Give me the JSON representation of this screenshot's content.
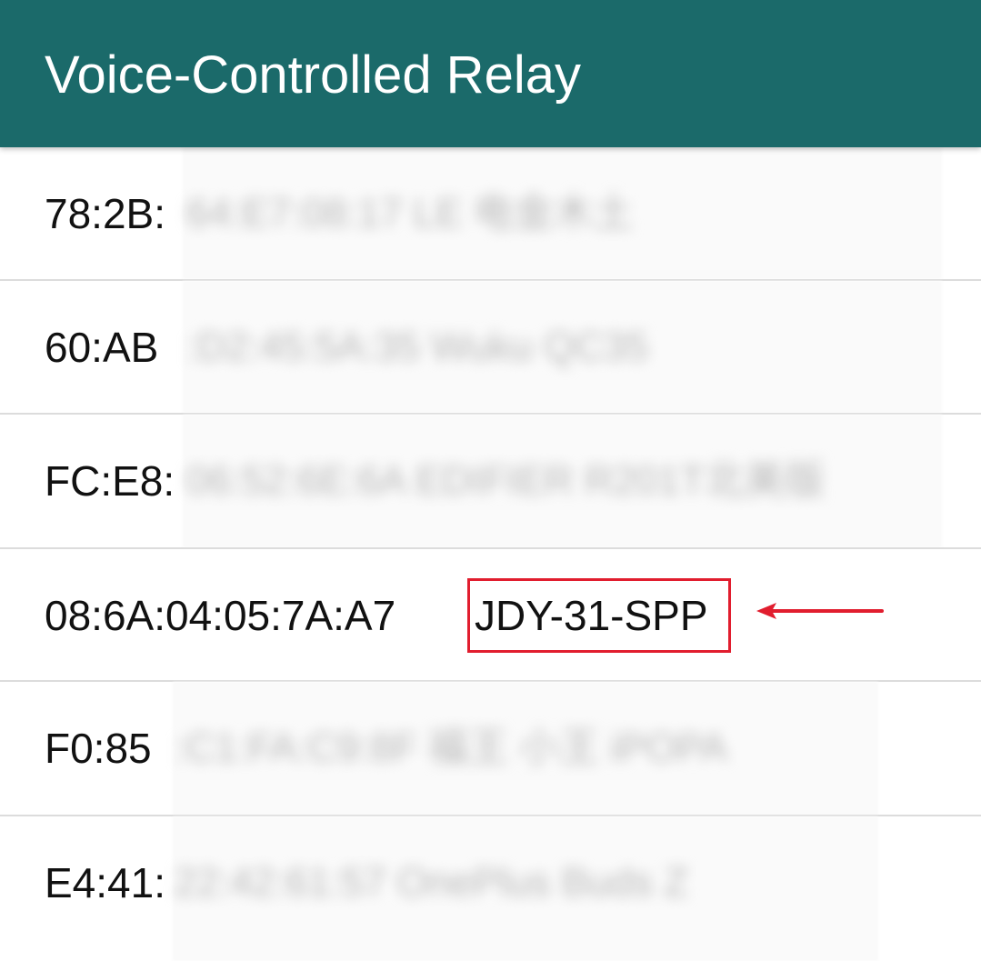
{
  "app_bar": {
    "title": "Voice-Controlled Relay",
    "background_color": "#1b6a6a"
  },
  "devices": [
    {
      "visible_text": "78:2B:",
      "name": "",
      "blurred_remainder": "64:E7:08:17 LE 电金木土"
    },
    {
      "visible_text": "60:AB",
      "name": "",
      "blurred_remainder": ":D2:45:5A:35 Wuku QC35"
    },
    {
      "visible_text": "FC:E8:",
      "name": "",
      "blurred_remainder": "06:52:6E:6A EDIFIER R201T北美版"
    },
    {
      "visible_text": "08:6A:04:05:7A:A7",
      "name": "JDY-31-SPP",
      "highlighted": true
    },
    {
      "visible_text": "F0:85",
      "name": "",
      "blurred_remainder": ":C1:FA:C9:8F 福王 小王 iPOPA"
    },
    {
      "visible_text": "E4:41:",
      "name": "",
      "blurred_remainder": "22:42:61:57 OnePlus Buds Z"
    }
  ],
  "annotation": {
    "highlight_color": "#e11d2e",
    "arrow_icon": "arrow-left-icon"
  }
}
